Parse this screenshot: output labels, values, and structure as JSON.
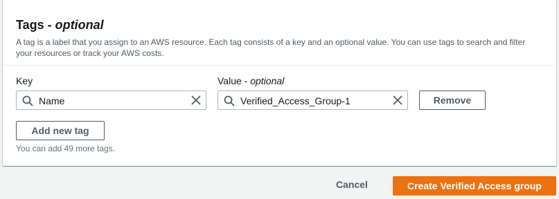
{
  "tags_section": {
    "title": "Tags - ",
    "title_optional": "optional",
    "description": "A tag is a label that you assign to an AWS resource. Each tag consists of a key and an optional value. You can use tags to search and filter your resources or track your AWS costs.",
    "key_label": "Key",
    "value_label": "Value - ",
    "value_label_optional": "optional",
    "tags": [
      {
        "key": "Name",
        "value": "Verified_Access_Group-1"
      }
    ],
    "remove_label": "Remove",
    "add_tag_label": "Add new tag",
    "remaining_hint": "You can add 49 more tags."
  },
  "footer": {
    "cancel_label": "Cancel",
    "create_label": "Create Verified Access group"
  },
  "colors": {
    "primary": "#ec7211",
    "text": "#16191f",
    "secondary_text": "#545b64"
  },
  "icons": {
    "search": "search-icon",
    "clear": "close-icon"
  }
}
